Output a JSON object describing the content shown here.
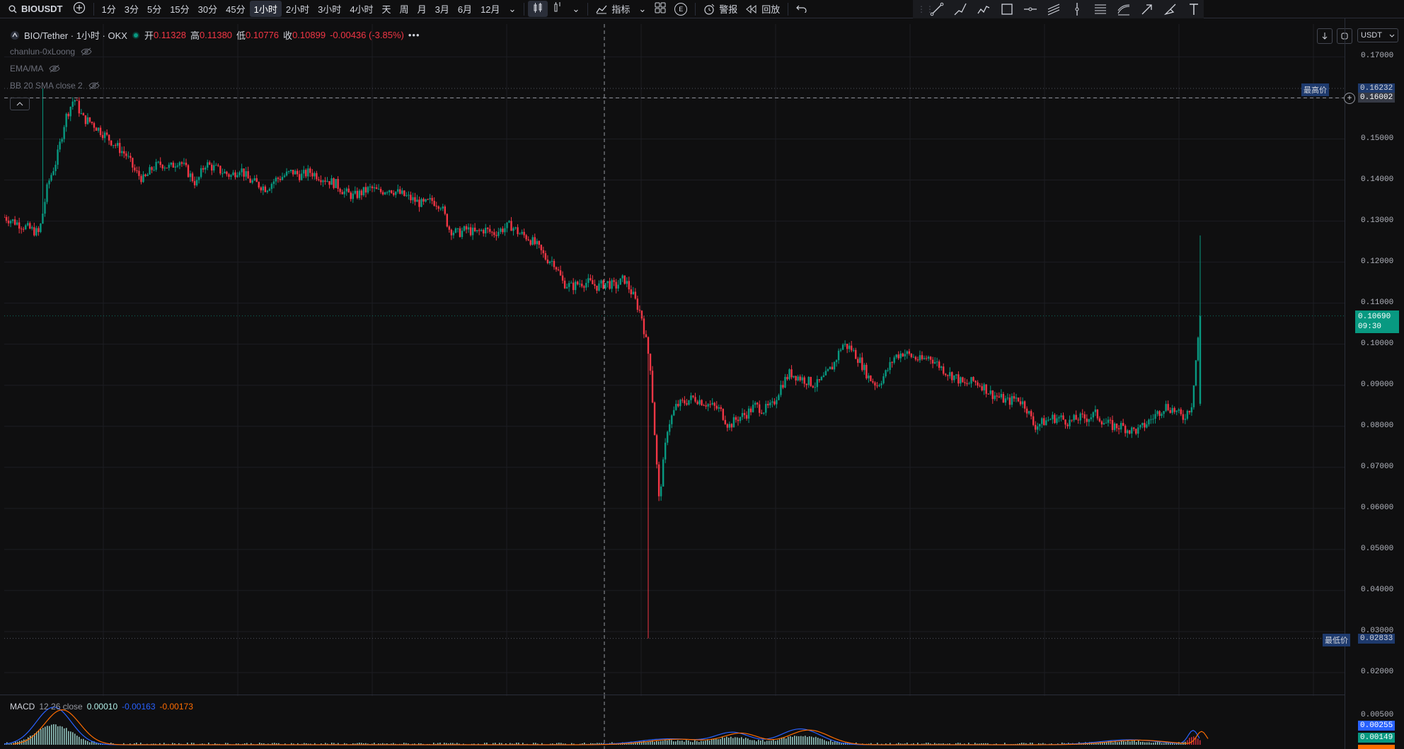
{
  "toolbar": {
    "symbol": "BIOUSDT",
    "intervals": [
      "1分",
      "3分",
      "5分",
      "15分",
      "30分",
      "45分",
      "1小时",
      "2小时",
      "3小时",
      "4小时",
      "天",
      "周",
      "月",
      "3月",
      "6月",
      "12月"
    ],
    "active_interval": "1小时",
    "indicators_label": "指标",
    "alerts_label": "警报",
    "replay_label": "回放",
    "e_badge": "E"
  },
  "legend": {
    "title": "BIO/Tether · 1小时 · OKX",
    "open_label": "开",
    "open": "0.11328",
    "high_label": "高",
    "high": "0.11380",
    "low_label": "低",
    "low": "0.10776",
    "close_label": "收",
    "close": "0.10899",
    "change": "-0.00436 (-3.85%)"
  },
  "indicators": {
    "chanlun": "chanlun-0xLoong",
    "ema": "EMA/MA",
    "bb": "BB 20 SMA close 2"
  },
  "macd": {
    "label": "MACD",
    "params": "12 26 close",
    "v1": "0.00010",
    "v2": "-0.00163",
    "v3": "-0.00173"
  },
  "currency": "USDT",
  "price_axis": {
    "labels": [
      "0.17000",
      "0.15000",
      "0.14000",
      "0.13000",
      "0.12000",
      "0.11000",
      "0.10000",
      "0.09000",
      "0.08000",
      "0.07000",
      "0.06000",
      "0.05000",
      "0.04000",
      "0.03000",
      "0.02000"
    ],
    "highest_label": "最高价",
    "highest_value": "0.16232",
    "crosshair_value": "0.16002",
    "last_price": "0.10690",
    "countdown": "09:30",
    "lowest_label": "最低价",
    "lowest_value": "0.02833",
    "macd_axis_label": "0.00500",
    "macd_tag1": "0.00255",
    "macd_tag2": "0.00149"
  },
  "colors": {
    "up": "#089981",
    "down": "#f23645",
    "background": "#0f0f10",
    "macd_line": "#2962ff",
    "signal_line": "#ff6d00"
  },
  "chart_data": {
    "type": "candlestick",
    "interval": "1小时",
    "y_range": [
      0.015,
      0.178
    ],
    "high": 0.16232,
    "low": 0.02833,
    "last": 0.1069,
    "close_path": [
      0.131,
      0.13,
      0.129,
      0.128,
      0.127,
      0.139,
      0.145,
      0.155,
      0.16,
      0.155,
      0.154,
      0.152,
      0.15,
      0.148,
      0.146,
      0.142,
      0.14,
      0.143,
      0.144,
      0.143,
      0.145,
      0.142,
      0.139,
      0.144,
      0.143,
      0.142,
      0.141,
      0.143,
      0.14,
      0.139,
      0.138,
      0.14,
      0.141,
      0.142,
      0.141,
      0.142,
      0.141,
      0.14,
      0.139,
      0.137,
      0.136,
      0.137,
      0.138,
      0.137,
      0.138,
      0.137,
      0.136,
      0.135,
      0.134,
      0.135,
      0.134,
      0.128,
      0.127,
      0.128,
      0.127,
      0.128,
      0.127,
      0.128,
      0.129,
      0.127,
      0.126,
      0.124,
      0.121,
      0.12,
      0.115,
      0.114,
      0.115,
      0.115,
      0.114,
      0.115,
      0.114,
      0.116,
      0.112,
      0.107,
      0.095,
      0.062,
      0.08,
      0.085,
      0.086,
      0.087,
      0.086,
      0.085,
      0.084,
      0.08,
      0.082,
      0.083,
      0.085,
      0.084,
      0.085,
      0.09,
      0.093,
      0.092,
      0.091,
      0.09,
      0.092,
      0.095,
      0.1,
      0.099,
      0.096,
      0.092,
      0.09,
      0.093,
      0.097,
      0.098,
      0.097,
      0.096,
      0.097,
      0.095,
      0.093,
      0.092,
      0.09,
      0.091,
      0.09,
      0.088,
      0.087,
      0.086,
      0.087,
      0.085,
      0.08,
      0.081,
      0.082,
      0.082,
      0.081,
      0.082,
      0.082,
      0.083,
      0.081,
      0.08,
      0.08,
      0.079,
      0.079,
      0.081,
      0.083,
      0.085,
      0.084,
      0.082,
      0.085,
      0.107
    ]
  }
}
